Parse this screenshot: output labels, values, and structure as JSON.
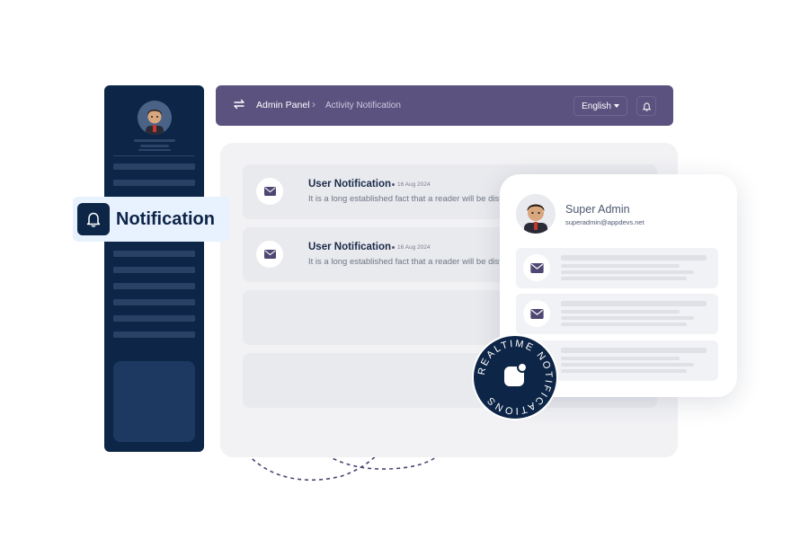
{
  "header": {
    "title": "Admin Panel",
    "current_page": "Activity Notification",
    "language": "English"
  },
  "notification_chip": {
    "label": "Notification"
  },
  "notifications": [
    {
      "title": "User Notification",
      "date": "16 Aug 2024",
      "body": "It is a long established fact that a reader will be distracted"
    },
    {
      "title": "User Notification",
      "date": "16 Aug 2024",
      "body": "It is a long established fact that a reader will be distracted"
    }
  ],
  "profile": {
    "name": "Super Admin",
    "email": "superadmin@appdevs.net"
  },
  "badge": {
    "text": "REALTIME NOTIFICATIONS"
  },
  "colors": {
    "sidebar": "#0d2547",
    "header": "#5c527f",
    "accent_text": "#1b2a4a"
  }
}
